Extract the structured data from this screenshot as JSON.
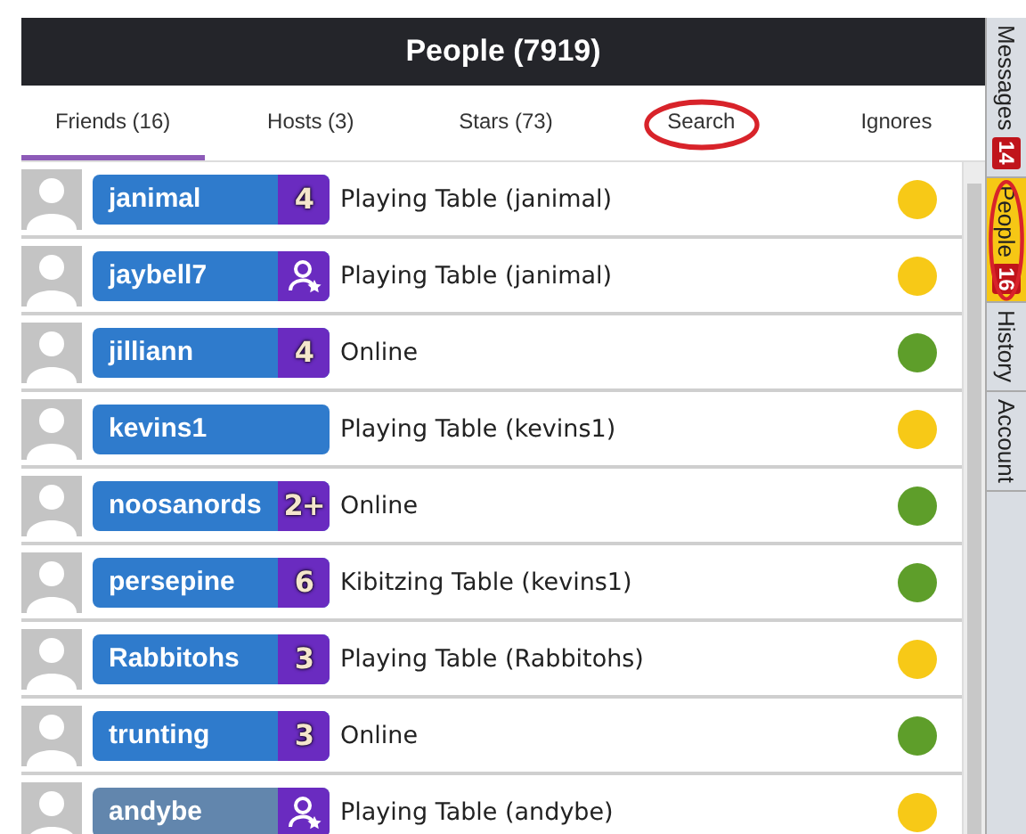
{
  "header": {
    "title": "People (7919)"
  },
  "tabs": [
    {
      "label": "Friends (16)",
      "selected": true,
      "circled": false
    },
    {
      "label": "Hosts (3)",
      "selected": false,
      "circled": false
    },
    {
      "label": "Stars (73)",
      "selected": false,
      "circled": false
    },
    {
      "label": "Search",
      "selected": false,
      "circled": true
    },
    {
      "label": "Ignores",
      "selected": false,
      "circled": false
    }
  ],
  "people": [
    {
      "name": "janimal",
      "badge": {
        "kind": "level",
        "text": "4"
      },
      "status": "Playing Table (janimal)",
      "color": "#f7c917",
      "dimmed": false
    },
    {
      "name": "jaybell7",
      "badge": {
        "kind": "host"
      },
      "status": "Playing Table (janimal)",
      "color": "#f7c917",
      "dimmed": false
    },
    {
      "name": "jilliann",
      "badge": {
        "kind": "level",
        "text": "4"
      },
      "status": "Online",
      "color": "#5e9e2a",
      "dimmed": false
    },
    {
      "name": "kevins1",
      "status": "Playing Table (kevins1)",
      "color": "#f7c917",
      "dimmed": false
    },
    {
      "name": "noosanords",
      "badge": {
        "kind": "level",
        "text": "2+"
      },
      "status": "Online",
      "color": "#5e9e2a",
      "dimmed": false
    },
    {
      "name": "persepine",
      "badge": {
        "kind": "level",
        "text": "6"
      },
      "status": "Kibitzing Table (kevins1)",
      "color": "#5e9e2a",
      "dimmed": false
    },
    {
      "name": "Rabbitohs",
      "badge": {
        "kind": "level",
        "text": "3"
      },
      "status": "Playing Table (Rabbitohs)",
      "color": "#f7c917",
      "dimmed": false
    },
    {
      "name": "trunting",
      "badge": {
        "kind": "level",
        "text": "3"
      },
      "status": "Online",
      "color": "#5e9e2a",
      "dimmed": false
    },
    {
      "name": "andybe",
      "badge": {
        "kind": "host"
      },
      "status": "Playing Table (andybe)",
      "color": "#f7c917",
      "dimmed": true
    }
  ],
  "side_tabs": [
    {
      "label": "Messages",
      "count": "14",
      "selected": false,
      "circled": false
    },
    {
      "label": "People",
      "count": "16",
      "selected": true,
      "circled": true
    },
    {
      "label": "History",
      "selected": false,
      "circled": false
    },
    {
      "label": "Account",
      "selected": false,
      "circled": false
    }
  ]
}
